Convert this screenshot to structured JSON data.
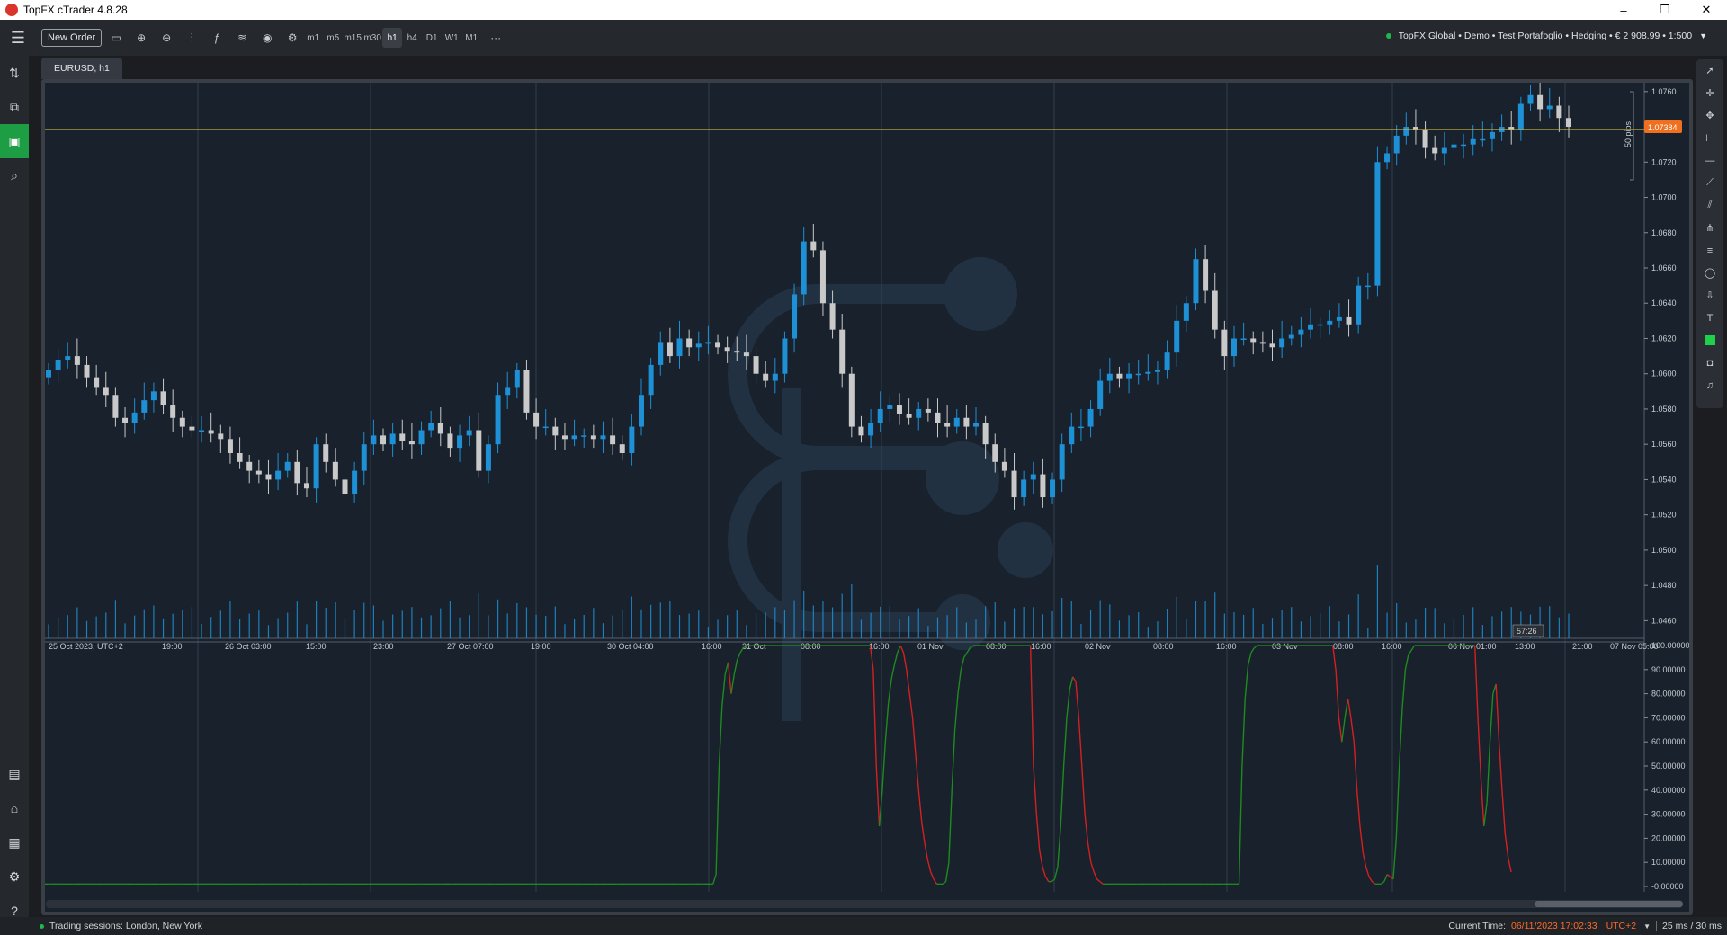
{
  "window": {
    "title": "TopFX cTrader 4.8.28",
    "controls": [
      "–",
      "❐",
      "✕"
    ]
  },
  "toolbar": {
    "new_order": "New Order",
    "timeframes": [
      "m1",
      "m5",
      "m15",
      "m30",
      "h1",
      "h4",
      "D1",
      "W1",
      "M1"
    ],
    "active_timeframe": "h1",
    "more": "···",
    "account": "TopFX Global • Demo • Test Portafoglio • Hedging • € 2 908.99 • 1:500"
  },
  "chart": {
    "tab": "EURUSD, h1",
    "current_price": "1.07384",
    "pips_label": "50 pips",
    "countdown": "57:26",
    "price_labels": [
      "1.0760",
      "1.0740",
      "1.0720",
      "1.0700",
      "1.0680",
      "1.0660",
      "1.0640",
      "1.0620",
      "1.0600",
      "1.0580",
      "1.0560",
      "1.0540",
      "1.0520",
      "1.0500",
      "1.0480",
      "1.0460"
    ],
    "time_labels": [
      "25 Oct 2023, UTC+2",
      "19:00",
      "26 Oct 03:00",
      "15:00",
      "23:00",
      "27 Oct 07:00",
      "19:00",
      "30 Oct 04:00",
      "16:00",
      "31 Oct",
      "08:00",
      "16:00",
      "01 Nov",
      "08:00",
      "16:00",
      "02 Nov",
      "08:00",
      "16:00",
      "03 Nov",
      "08:00",
      "16:00",
      "06 Nov 01:00",
      "13:00",
      "21:00",
      "07 Nov 05:00"
    ],
    "indicator_labels": [
      "100.00000",
      "90.00000",
      "80.00000",
      "70.00000",
      "60.00000",
      "50.00000",
      "40.00000",
      "30.00000",
      "20.00000",
      "10.00000",
      "-0.00000"
    ],
    "colors": {
      "bull": "#1e90d6",
      "bear": "#c9c9c9",
      "price_line": "#c5b23a",
      "indicator_up": "#1f8a1f",
      "indicator_down": "#d42020",
      "price_badge": "#f07020"
    }
  },
  "chart_data": {
    "type": "candlestick",
    "symbol": "EURUSD",
    "timeframe": "h1",
    "ylim": [
      1.045,
      1.0765
    ],
    "current_price": 1.07384,
    "closes": [
      1.0602,
      1.0608,
      1.061,
      1.0605,
      1.0598,
      1.0592,
      1.0588,
      1.0575,
      1.0572,
      1.0578,
      1.0585,
      1.059,
      1.0582,
      1.0575,
      1.057,
      1.0568,
      1.0568,
      1.0566,
      1.0563,
      1.0555,
      1.055,
      1.0545,
      1.0543,
      1.054,
      1.0545,
      1.055,
      1.0538,
      1.0535,
      1.056,
      1.055,
      1.054,
      1.0532,
      1.0545,
      1.056,
      1.0565,
      1.056,
      1.0566,
      1.0562,
      1.056,
      1.0568,
      1.0572,
      1.0566,
      1.0558,
      1.0565,
      1.0568,
      1.0545,
      1.056,
      1.0588,
      1.0592,
      1.0602,
      1.0578,
      1.057,
      1.057,
      1.0565,
      1.0563,
      1.0565,
      1.0565,
      1.0563,
      1.0565,
      1.056,
      1.0555,
      1.057,
      1.0588,
      1.0605,
      1.0618,
      1.061,
      1.062,
      1.0615,
      1.0617,
      1.0618,
      1.0615,
      1.0613,
      1.0612,
      1.061,
      1.06,
      1.0596,
      1.06,
      1.062,
      1.0645,
      1.0675,
      1.067,
      1.064,
      1.0625,
      1.06,
      1.057,
      1.0565,
      1.0572,
      1.058,
      1.0582,
      1.0577,
      1.0575,
      1.058,
      1.0578,
      1.0572,
      1.057,
      1.0575,
      1.057,
      1.0572,
      1.056,
      1.055,
      1.0545,
      1.053,
      1.054,
      1.0543,
      1.053,
      1.054,
      1.056,
      1.057,
      1.057,
      1.058,
      1.0596,
      1.06,
      1.0597,
      1.06,
      1.06,
      1.0601,
      1.0602,
      1.0612,
      1.063,
      1.064,
      1.0665,
      1.0647,
      1.0625,
      1.061,
      1.062,
      1.062,
      1.0618,
      1.0617,
      1.0615,
      1.062,
      1.0622,
      1.0625,
      1.0628,
      1.0628,
      1.063,
      1.0632,
      1.0628,
      1.065,
      1.065,
      1.072,
      1.0725,
      1.0735,
      1.074,
      1.0738,
      1.0728,
      1.0725,
      1.0728,
      1.073,
      1.073,
      1.0733,
      1.0733,
      1.0737,
      1.074,
      1.0738,
      1.0753,
      1.0758,
      1.075,
      1.0752,
      1.0745,
      1.074
    ],
    "indicator": {
      "ylim": [
        0,
        100
      ],
      "values": [
        1,
        1,
        1,
        1,
        1,
        1,
        1,
        1,
        1,
        1,
        1,
        1,
        1,
        1,
        1,
        1,
        1,
        1,
        1,
        1,
        1,
        1,
        1,
        1,
        1,
        1,
        1,
        1,
        1,
        1,
        1,
        1,
        1,
        1,
        1,
        1,
        1,
        1,
        1,
        1,
        1,
        1,
        1,
        1,
        1,
        1,
        1,
        1,
        1,
        1,
        1,
        1,
        1,
        1,
        1,
        1,
        1,
        1,
        1,
        1,
        1,
        1,
        1,
        1,
        1,
        1,
        1,
        1,
        1,
        1,
        1,
        1,
        1,
        1,
        1,
        1,
        1,
        1,
        1,
        1,
        1,
        1,
        1,
        1,
        1,
        1,
        1,
        1,
        1,
        1,
        1,
        1,
        1,
        1,
        1,
        1,
        1,
        1,
        1,
        1,
        1,
        1,
        1,
        1,
        1,
        1,
        1,
        1,
        1,
        1,
        1,
        1,
        1,
        1,
        1,
        1,
        1,
        1,
        1,
        1,
        1,
        1,
        1,
        1,
        1,
        1,
        1,
        1,
        1,
        1,
        1,
        1,
        1,
        1,
        1,
        1,
        1,
        1,
        1,
        1,
        1,
        1,
        1,
        1,
        1,
        1,
        1,
        1,
        1,
        1,
        1,
        1,
        1,
        1,
        1,
        1,
        1,
        1,
        1,
        1,
        1,
        1,
        1,
        1,
        1,
        1,
        1,
        1,
        1,
        1,
        1,
        1,
        1,
        1,
        1,
        1,
        1,
        1,
        1,
        1,
        1,
        1,
        1,
        1,
        1,
        1,
        1,
        1,
        1,
        1,
        1,
        1,
        1,
        1,
        1,
        1,
        1,
        1,
        1,
        1,
        1,
        1,
        1,
        1,
        1,
        1,
        1,
        1,
        1,
        1,
        1,
        1,
        1,
        1,
        1,
        1,
        1,
        1,
        1,
        1,
        1,
        1,
        5,
        50,
        75,
        88,
        93,
        80,
        88,
        94,
        97,
        99,
        100,
        100,
        100,
        100,
        100,
        100,
        100,
        100,
        100,
        100,
        100,
        100,
        100,
        100,
        100,
        100,
        100,
        100,
        100,
        100,
        100,
        100,
        100,
        100,
        100,
        100,
        100,
        100,
        100,
        100,
        100,
        100,
        100,
        100,
        100,
        100,
        100,
        100,
        100,
        100,
        100,
        100,
        90,
        50,
        25,
        40,
        60,
        76,
        86,
        92,
        97,
        100,
        97,
        90,
        80,
        70,
        55,
        40,
        27,
        18,
        11,
        6,
        3,
        1,
        1,
        1,
        2,
        10,
        40,
        65,
        80,
        90,
        95,
        97,
        99,
        100,
        100,
        100,
        100,
        100,
        100,
        100,
        100,
        100,
        100,
        100,
        100,
        100,
        100,
        100,
        100,
        100,
        100,
        100,
        100,
        50,
        30,
        15,
        8,
        4,
        2,
        2,
        3,
        8,
        25,
        50,
        70,
        82,
        87,
        85,
        70,
        50,
        30,
        18,
        10,
        6,
        3,
        2,
        1,
        1,
        1,
        1,
        1,
        1,
        1,
        1,
        1,
        1,
        1,
        1,
        1,
        1,
        1,
        1,
        1,
        1,
        1,
        1,
        1,
        1,
        1,
        1,
        1,
        1,
        1,
        1,
        1,
        1,
        1,
        1,
        1,
        1,
        1,
        1,
        1,
        1,
        1,
        1,
        1,
        1,
        1,
        1,
        1,
        1,
        50,
        78,
        92,
        97,
        99,
        100,
        100,
        100,
        100,
        100,
        100,
        100,
        100,
        100,
        100,
        100,
        100,
        100,
        100,
        100,
        100,
        100,
        100,
        100,
        100,
        100,
        100,
        100,
        100,
        100,
        100,
        90,
        70,
        60,
        70,
        78,
        70,
        60,
        40,
        25,
        14,
        8,
        4,
        2,
        1,
        1,
        1,
        2,
        5,
        4,
        3,
        20,
        50,
        74,
        90,
        96,
        98,
        100,
        100,
        100,
        100,
        100,
        100,
        100,
        100,
        100,
        100,
        100,
        100,
        100,
        100,
        100,
        100,
        100,
        100,
        100,
        100,
        100,
        70,
        45,
        25,
        35,
        60,
        80,
        84,
        60,
        40,
        22,
        12,
        6
      ]
    }
  },
  "status": {
    "sessions": "Trading sessions: London, New York",
    "current_time_label": "Current Time:",
    "current_time": "06/11/2023 17:02:33",
    "timezone": "UTC+2",
    "latency": "25 ms / 30 ms"
  }
}
